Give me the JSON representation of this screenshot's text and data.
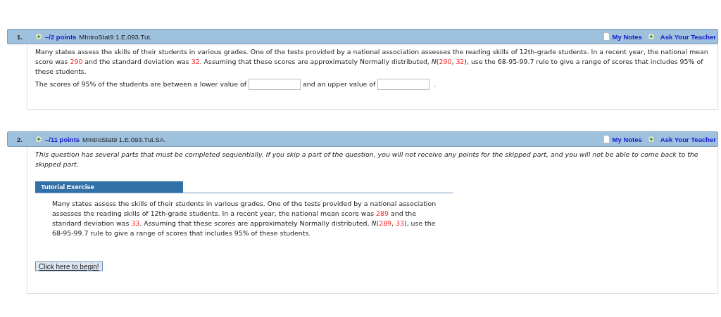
{
  "questions": [
    {
      "number": "1.",
      "points": "–/2 points",
      "code": "MIntroStat9 1.E.093.Tut.",
      "notes": "My Notes",
      "ask": "Ask Your Teacher",
      "body": [
        {
          "kind": "paragraph",
          "segments": [
            {
              "kind": "text",
              "text": "Many states assess the skills of their students in various grades. One of the tests provided by a national association assesses the reading skills of 12th-grade students. In a recent year, the national mean score was "
            },
            {
              "kind": "value",
              "text": "290"
            },
            {
              "kind": "text",
              "text": " and the standard deviation was "
            },
            {
              "kind": "value",
              "text": "32"
            },
            {
              "kind": "text",
              "text": ". Assuming that these scores are approximately Normally distributed, *N*("
            },
            {
              "kind": "value",
              "text": "290"
            },
            {
              "kind": "text",
              "text": ", "
            },
            {
              "kind": "value",
              "text": "32"
            },
            {
              "kind": "text",
              "text": "), use the 68-95-99.7 rule to give a range of scores that includes 95% of these students."
            }
          ]
        },
        {
          "kind": "answer",
          "parts": [
            "The scores of 95% of the students are between a lower value of",
            "and an upper value of",
            "."
          ]
        }
      ]
    },
    {
      "number": "2.",
      "points": "–/11 points",
      "code": "MIntroStat9 1.E.093.Tut.SA.",
      "notes": "My Notes",
      "ask": "Ask Your Teacher",
      "body": [
        {
          "kind": "note",
          "segments": [
            {
              "kind": "text",
              "text": "This question has several parts that must be completed sequentially. If you skip a part of the question, you will not receive any points for the skipped part, and you will not be able to come back to the skipped part."
            }
          ]
        },
        {
          "kind": "tutorial",
          "title": "Tutorial Exercise",
          "segments": [
            {
              "kind": "text",
              "text": "Many states assess the skills of their students in various grades. One of the tests provided by a national association assesses the reading skills of 12th-grade students. In a recent year, the national mean score was "
            },
            {
              "kind": "value",
              "text": "289"
            },
            {
              "kind": "text",
              "text": " and the standard deviation was "
            },
            {
              "kind": "value",
              "text": "33"
            },
            {
              "kind": "text",
              "text": ". Assuming that these scores are approximately Normally distributed, *N*("
            },
            {
              "kind": "value",
              "text": "289"
            },
            {
              "kind": "text",
              "text": ", "
            },
            {
              "kind": "value",
              "text": "33"
            },
            {
              "kind": "text",
              "text": "), use the 68-95-99.7 rule to give a range of scores that includes 95% of these students."
            }
          ],
          "button": "Click here to begin!"
        }
      ]
    }
  ]
}
